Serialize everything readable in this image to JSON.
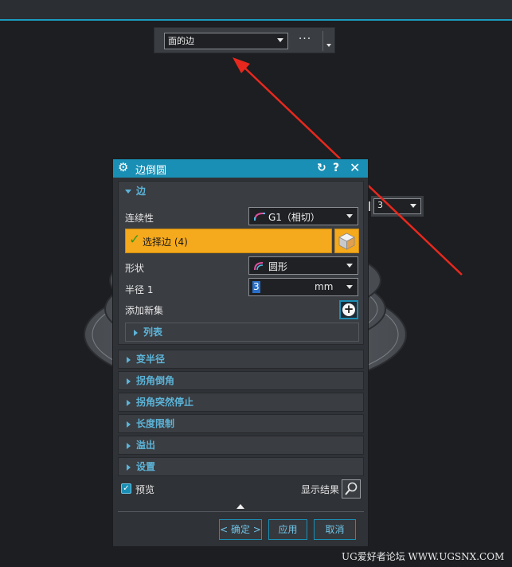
{
  "selection_bar": {
    "filter_value": "面的边",
    "more_label": "···"
  },
  "floating_input": {
    "value": "3"
  },
  "dialog": {
    "title": "边倒圆",
    "edge_group": {
      "header": "边",
      "continuity_label": "连续性",
      "continuity_value": "G1（相切）",
      "select_edge_label": "选择边 (4)",
      "shape_label": "形状",
      "shape_value": "圆形",
      "radius_label": "半径 1",
      "radius_value": "3",
      "radius_unit": "mm",
      "add_new_set_label": "添加新集",
      "list_label": "列表"
    },
    "sections": [
      "变半径",
      "拐角倒角",
      "拐角突然停止",
      "长度限制",
      "溢出",
      "设置"
    ],
    "preview_label": "预览",
    "show_result_label": "显示结果",
    "buttons": {
      "ok": "< 确定 >",
      "apply": "应用",
      "cancel": "取消"
    }
  },
  "watermark": "UG爱好者论坛 WWW.UGSNX.COM",
  "colors": {
    "accent": "#1a8fb5",
    "highlight": "#f5a91c",
    "background": "#1c1e21",
    "arrow": "#e8281e"
  }
}
